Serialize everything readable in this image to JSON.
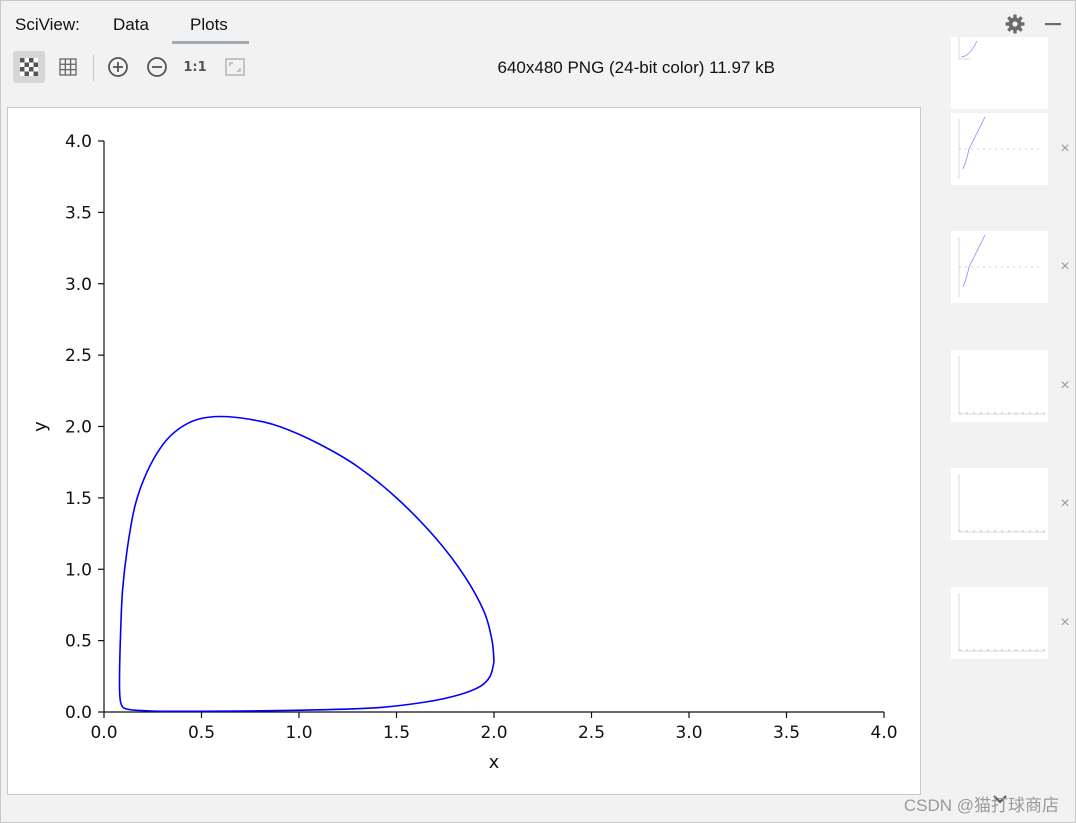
{
  "header": {
    "brand": "SciView:",
    "tabs": [
      {
        "label": "Data",
        "active": false
      },
      {
        "label": "Plots",
        "active": true
      }
    ],
    "icons": {
      "settings": "gear-icon",
      "minimize": "minimize-icon"
    }
  },
  "toolbar": {
    "buttons": [
      {
        "icon": "checkerboard-background-icon",
        "active": true
      },
      {
        "icon": "grid-icon",
        "active": false
      },
      {
        "icon": "zoom-in-icon"
      },
      {
        "icon": "zoom-out-icon"
      },
      {
        "icon": "actual-size-icon",
        "label": "1:1"
      },
      {
        "icon": "fit-to-window-icon"
      }
    ],
    "image_info": "640x480 PNG (24-bit color) 11.97 kB"
  },
  "colors": {
    "curve": "#0000ff",
    "tab_underline": "#a2a9b6",
    "panel_bg": "#f2f2f2"
  },
  "chart_data": {
    "type": "line",
    "title": "",
    "xlabel": "x",
    "ylabel": "y",
    "xlim": [
      0.0,
      4.0
    ],
    "ylim": [
      0.0,
      4.0
    ],
    "xticks": [
      "0.0",
      "0.5",
      "1.0",
      "1.5",
      "2.0",
      "2.5",
      "3.0",
      "3.5",
      "4.0"
    ],
    "yticks": [
      "0.0",
      "0.5",
      "1.0",
      "1.5",
      "2.0",
      "2.5",
      "3.0",
      "3.5",
      "4.0"
    ],
    "grid": false,
    "series": [
      {
        "color": "#0000ff",
        "x": [
          2.0,
          1.99,
          1.95,
          1.85,
          1.7,
          1.5,
          1.3,
          1.1,
          0.9,
          0.75,
          0.6,
          0.48,
          0.38,
          0.3,
          0.22,
          0.16,
          0.12,
          0.095,
          0.085,
          0.08,
          0.08,
          0.085,
          0.1,
          0.14,
          0.2,
          0.3,
          0.5,
          0.8,
          1.1,
          1.4,
          1.65,
          1.82,
          1.93,
          1.98,
          2.0
        ],
        "y": [
          0.35,
          0.5,
          0.7,
          0.95,
          1.22,
          1.5,
          1.72,
          1.88,
          2.0,
          2.05,
          2.07,
          2.05,
          1.98,
          1.87,
          1.68,
          1.45,
          1.15,
          0.85,
          0.55,
          0.3,
          0.15,
          0.07,
          0.03,
          0.015,
          0.01,
          0.005,
          0.005,
          0.008,
          0.015,
          0.03,
          0.07,
          0.12,
          0.18,
          0.25,
          0.35
        ]
      }
    ]
  },
  "thumbnails": {
    "items": [
      {
        "kind": "partial-curve",
        "closable": false
      },
      {
        "kind": "curve-with-axis",
        "closable": true
      },
      {
        "kind": "curve-with-axis",
        "closable": true
      },
      {
        "kind": "empty-axes",
        "closable": true
      },
      {
        "kind": "empty-axes",
        "closable": true
      },
      {
        "kind": "empty-axes",
        "closable": true
      }
    ],
    "close_symbol": "×",
    "scroll_icon": "chevron-down-icon"
  },
  "watermark": "CSDN @猫打球商店"
}
